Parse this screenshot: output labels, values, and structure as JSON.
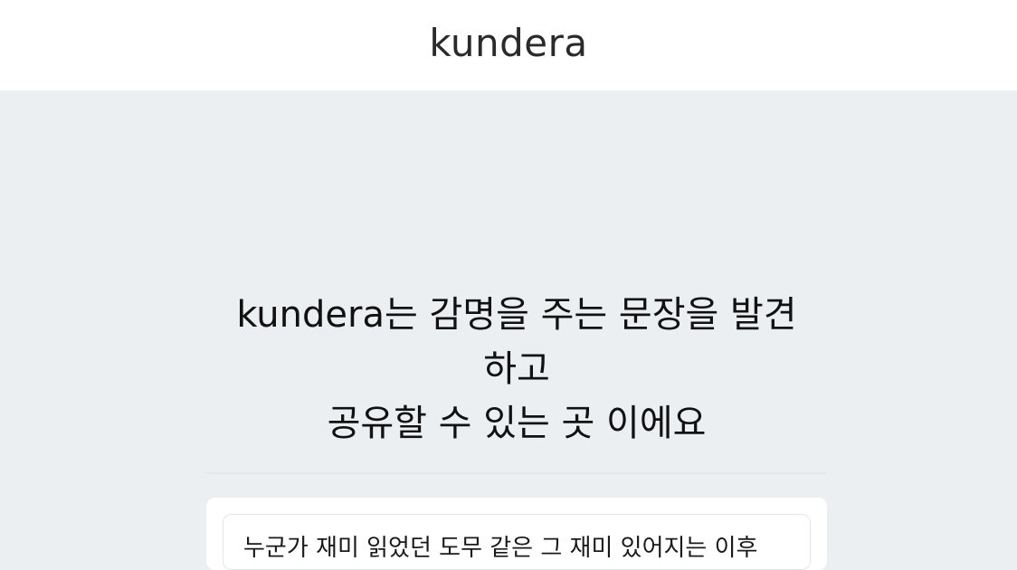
{
  "header": {
    "logo": "kundera"
  },
  "hero": {
    "lines": [
      "kundera는 감명을 주는 문장을 발견",
      "하고",
      "공유할 수 있는 곳 이에요"
    ]
  },
  "card": {
    "quote_text": "누군가 재미 읽었던 도무 같은 그 재미 있어지는 이후"
  }
}
